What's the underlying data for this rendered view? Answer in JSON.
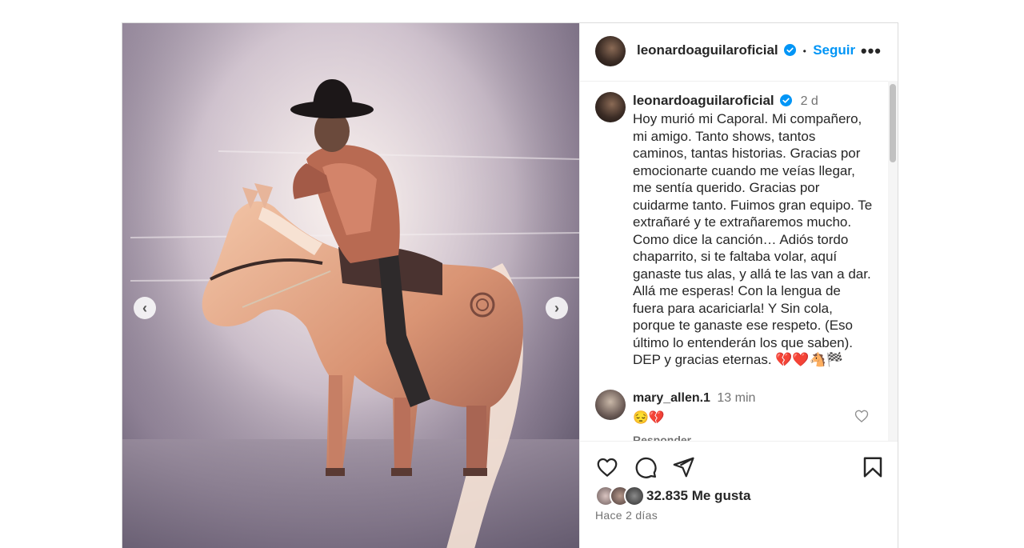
{
  "header": {
    "username": "leonardoaguilaroficial",
    "separator": "•",
    "follow_label": "Seguir",
    "more_label": "•••"
  },
  "caption": {
    "username": "leonardoaguilaroficial",
    "time": "2 d",
    "text": "Hoy murió mi Caporal. Mi compañero, mi amigo. Tanto shows, tantos caminos, tantas historias. Gracias por emocionarte cuando me veías llegar, me sentía querido. Gracias por cuidarme tanto. Fuimos gran equipo. Te extrañaré y te extrañaremos mucho. Como dice la canción… Adiós tordo chaparrito, si te faltaba volar, aquí ganaste tus alas, y allá te las van a dar. Allá me esperas! Con la lengua de fuera para acariciarla! Y Sin cola, porque te ganaste ese respeto. (Eso último lo entenderán los que saben). DEP y gracias eternas. 💔❤️🐴🏁"
  },
  "comment": {
    "username": "mary_allen.1",
    "time": "13 min",
    "text": "😔💔",
    "reply_label": "Responder"
  },
  "media": {
    "prev_label": "‹",
    "next_label": "›"
  },
  "footer": {
    "likes": "32.835 Me gusta",
    "ago": "Hace 2 días"
  },
  "colors": {
    "accent": "#0095f6",
    "verified": "#0095f6",
    "muted": "#737373"
  },
  "icons": [
    "heart-icon",
    "comment-icon",
    "share-icon",
    "bookmark-icon",
    "verified-icon",
    "more-icon",
    "chevron-left-icon",
    "chevron-right-icon"
  ]
}
